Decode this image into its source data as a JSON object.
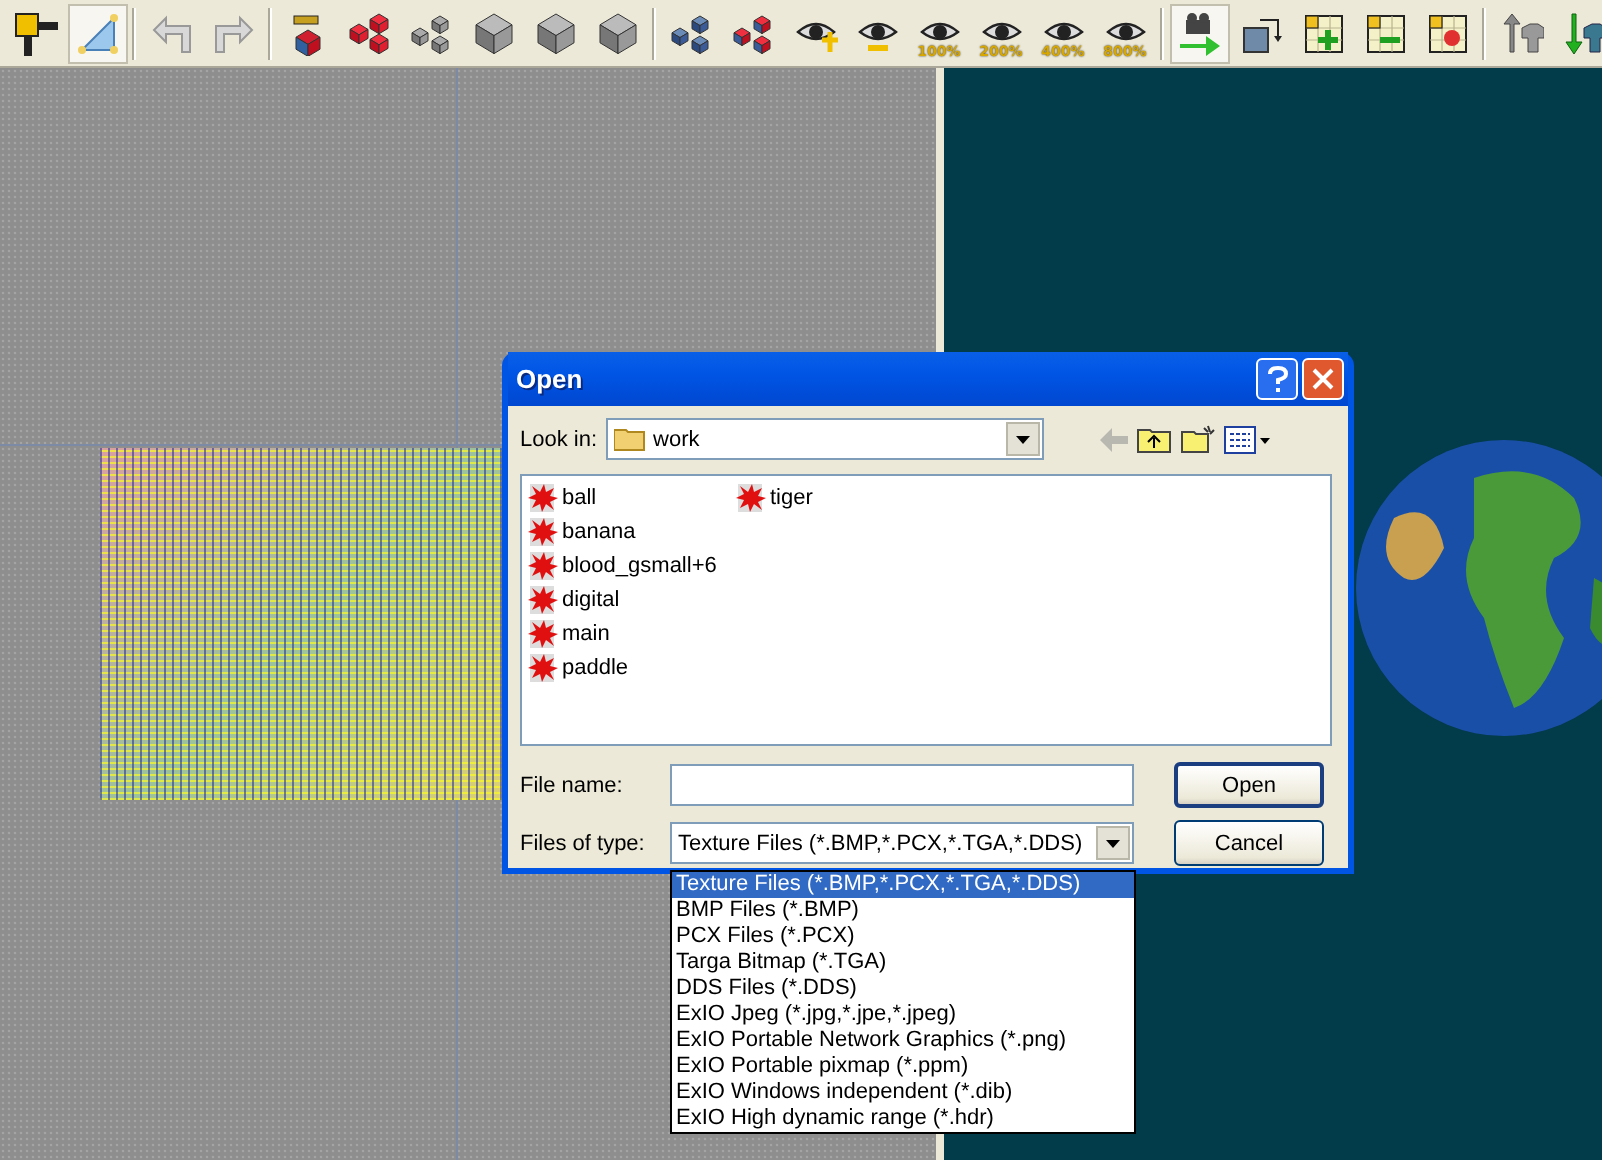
{
  "toolbar": {
    "groups": [
      [
        {
          "kind": "pin-handle",
          "selected": false
        },
        {
          "kind": "triangle",
          "selected": true
        }
      ],
      [
        {
          "kind": "undo",
          "selected": false
        },
        {
          "kind": "redo",
          "selected": false
        }
      ],
      [
        {
          "kind": "pushpin-cube",
          "selected": false
        },
        {
          "kind": "red-cubes",
          "selected": false
        },
        {
          "kind": "grey-cubes",
          "selected": false
        },
        {
          "kind": "cube",
          "selected": false
        },
        {
          "kind": "cube",
          "selected": false
        },
        {
          "kind": "cube",
          "selected": false
        }
      ],
      [
        {
          "kind": "blue-cubes",
          "selected": false
        },
        {
          "kind": "mixed-cubes",
          "selected": false
        },
        {
          "kind": "eye-plus",
          "selected": false
        },
        {
          "kind": "eye-minus",
          "selected": false
        },
        {
          "kind": "eye-zoom",
          "label": "100%",
          "selected": false
        },
        {
          "kind": "eye-zoom",
          "label": "200%",
          "selected": false
        },
        {
          "kind": "eye-zoom",
          "label": "400%",
          "selected": false
        },
        {
          "kind": "eye-zoom",
          "label": "800%",
          "selected": false
        }
      ],
      [
        {
          "kind": "camera-move",
          "selected": true
        },
        {
          "kind": "rotate",
          "selected": false
        },
        {
          "kind": "grid-add",
          "selected": false
        },
        {
          "kind": "grid-remove",
          "selected": false
        },
        {
          "kind": "grid-light",
          "selected": false
        }
      ],
      [
        {
          "kind": "shirt-up",
          "selected": false
        },
        {
          "kind": "shirt-down",
          "selected": false
        }
      ]
    ]
  },
  "dialog": {
    "title": "Open",
    "look_in": {
      "label": "Look in:",
      "value": "work"
    },
    "files": [
      {
        "name": "ball"
      },
      {
        "name": "banana"
      },
      {
        "name": "blood_gsmall+6"
      },
      {
        "name": "digital"
      },
      {
        "name": "main"
      },
      {
        "name": "paddle"
      },
      {
        "name": "tiger"
      }
    ],
    "file_name": {
      "label": "File name:"
    },
    "files_of_type": {
      "label": "Files of type:",
      "value": "Texture Files (*.BMP,*.PCX,*.TGA,*.DDS)",
      "options": [
        {
          "label": "Texture Files (*.BMP,*.PCX,*.TGA,*.DDS)",
          "selected": true
        },
        {
          "label": "BMP Files (*.BMP)",
          "selected": false
        },
        {
          "label": "PCX Files (*.PCX)",
          "selected": false
        },
        {
          "label": "Targa Bitmap (*.TGA)",
          "selected": false
        },
        {
          "label": "DDS Files (*.DDS)",
          "selected": false
        },
        {
          "label": "ExIO Jpeg (*.jpg,*.jpe,*.jpeg)",
          "selected": false
        },
        {
          "label": "ExIO Portable Network Graphics (*.png)",
          "selected": false
        },
        {
          "label": "ExIO Portable pixmap (*.ppm)",
          "selected": false
        },
        {
          "label": "ExIO Windows independent (*.dib)",
          "selected": false
        },
        {
          "label": "ExIO High dynamic range (*.hdr)",
          "selected": false
        }
      ]
    },
    "buttons": [
      {
        "label": "Open",
        "kind": "default"
      },
      {
        "label": "Cancel",
        "kind": "normal"
      }
    ]
  }
}
